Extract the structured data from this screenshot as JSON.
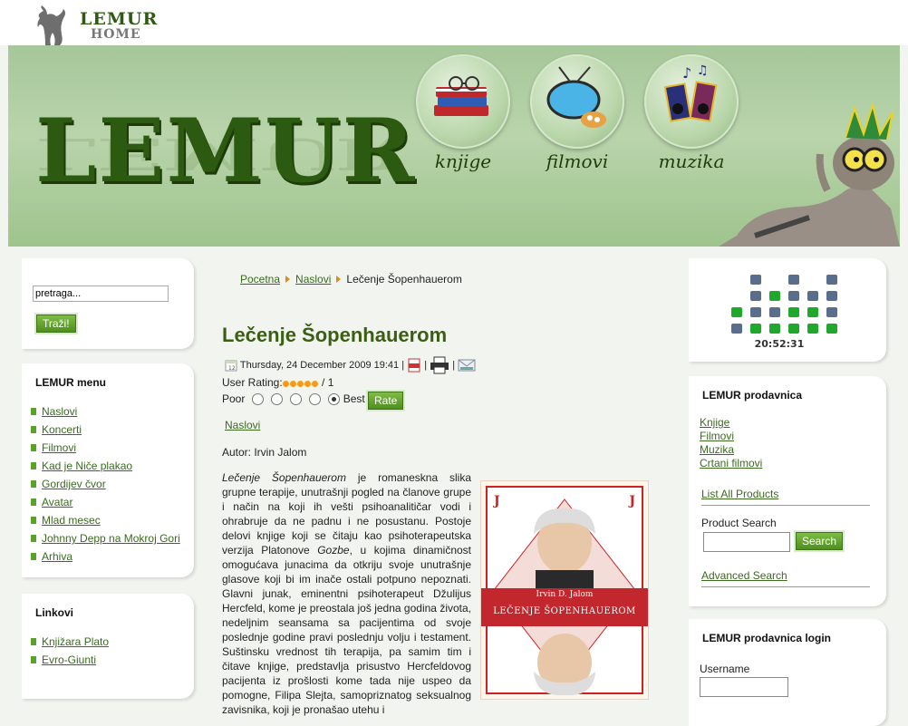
{
  "header": {
    "logo_top": "LEMUR",
    "logo_bottom": "HOME",
    "banner_title": "LEMUR",
    "nav": [
      {
        "label": "knjige",
        "icon": "books-icon"
      },
      {
        "label": "filmovi",
        "icon": "tv-icon"
      },
      {
        "label": "muzika",
        "icon": "music-icon"
      }
    ]
  },
  "search": {
    "value": "pretraga...",
    "button": "Traži!"
  },
  "menu": {
    "title": "LEMUR menu",
    "items": [
      "Naslovi",
      "Koncerti",
      "Filmovi",
      "Kad je Niče plakao",
      "Gordijev čvor",
      "Avatar",
      "Mlad mesec",
      "Johnny Depp na Mokroj Gori",
      "Arhiva"
    ]
  },
  "links": {
    "title": "Linkovi",
    "items": [
      "Knjižara Plato",
      "Evro-Giunti"
    ]
  },
  "breadcrumb": {
    "home": "Pocetna",
    "section": "Naslovi",
    "current": "Lečenje Šopenhauerom"
  },
  "article": {
    "title": "Lečenje Šopenhauerom",
    "date": "Thursday, 24 December 2009 19:41",
    "sep": "|",
    "rating_label": "User Rating:",
    "rating_value": 5,
    "rating_count": " / 1",
    "poll_poor": "Poor",
    "poll_best": "Best",
    "rate_button": "Rate",
    "category": "Naslovi",
    "author": "Autor: Irvin Jalom",
    "lead_italic": "Lečenje Šopenhauerom",
    "p1": " je romaneskna slika grupne terapije, unutrašnji pogled na članove grupe i način na koji ih vešti psihoanalitičar vodi i ohrabruje da ne padnu i ne posustanu. Postoje delovi knjige koji se čitaju kao psihoterapeutska verzija Platonove ",
    "p1_italic": "Gozbe",
    "p1_end": ", u kojima dinamičnost omogućava junacima da otkriju svoje unutrašnje glasove koji bi im inače ostali potpuno nepoznati. Glavni junak, eminentni psihoterapeut Džulijus Hercfeld, kome je preostala još jedna godina života, nedeljnim seansama sa pacijentima od svoje poslednje godine pravi poslednju volju i testament. Suštinsku vrednost tih terapija, pa samim tim i čitave knjige, predstavlja prisustvo Hercfeldovog pacijenta iz prošlosti kome tada nije uspeo da pomogne, Filipa Slejta, samopriznatog seksualnog zavisnika, koji je pronašao utehu i",
    "book_author": "Irvin D. Jalom",
    "book_title": "LEČENJE ŠOPENHAUEROM",
    "card_rank": "J"
  },
  "clock": {
    "time": "20:52:31"
  },
  "shop": {
    "title": "LEMUR prodavnica",
    "links": [
      "Knjige",
      "Filmovi",
      "Muzika",
      "Crtani filmovi"
    ],
    "all_products": "List All Products",
    "product_search_label": "Product Search",
    "search_button": "Search",
    "advanced_search": "Advanced Search"
  },
  "login": {
    "title": "LEMUR prodavnica login",
    "username_label": "Username"
  },
  "colors": {
    "accent_green": "#3b5e14",
    "button_green": "#5a9a27",
    "breadcrumb_arrow": "#e08a18"
  }
}
